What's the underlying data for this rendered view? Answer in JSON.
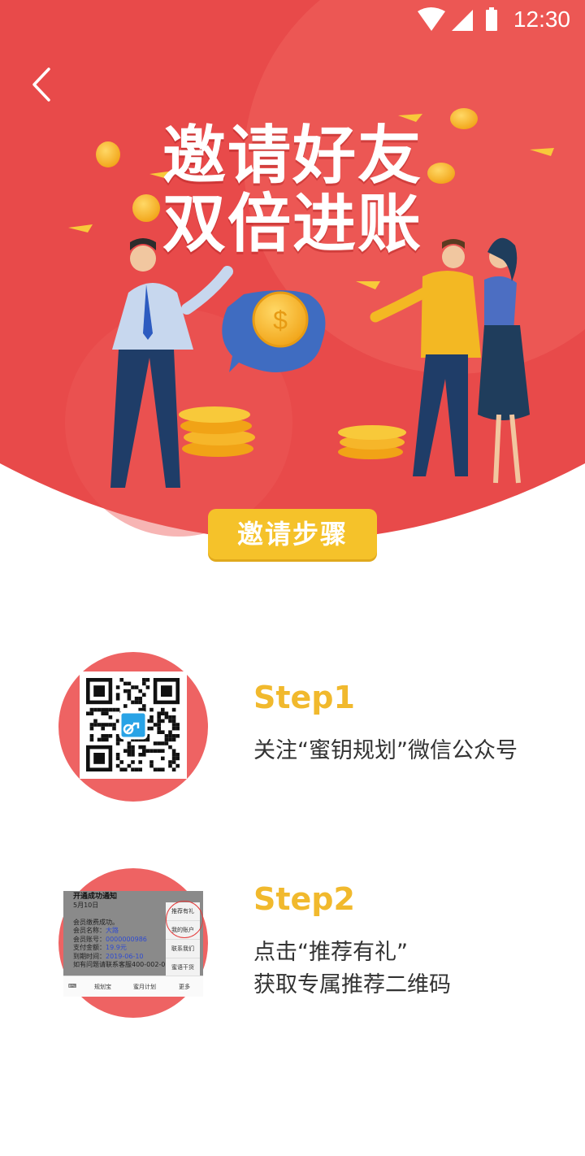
{
  "status_bar": {
    "time": "12:30",
    "icons": [
      "wifi-icon",
      "signal-icon",
      "battery-icon"
    ]
  },
  "header": {
    "back_icon": "chevron-left-icon"
  },
  "hero": {
    "title_line1": "邀请好友",
    "title_line2": "双倍进账",
    "button_label": "邀请步骤"
  },
  "steps": [
    {
      "title": "Step1",
      "desc_lines": [
        "关注“蜜钥规划”微信公众号"
      ]
    },
    {
      "title": "Step2",
      "desc_lines": [
        "点击“推荐有礼”",
        "获取专属推荐二维码"
      ]
    }
  ],
  "step2_screenshot": {
    "message_title": "开通成功通知",
    "message_date": "5月10日",
    "message_lines": [
      "会员缴费成功。",
      "会员名称：",
      "会员账号：",
      "支付金额：",
      "到期时间：",
      "如有问题请联系客服400-002-065"
    ],
    "message_values": [
      "",
      "大路",
      "0000000986",
      "19.9元",
      "2019-06-10",
      ""
    ],
    "menu_items": [
      "推荐有礼",
      "我的账户",
      "联系我们",
      "蜜语干货"
    ],
    "tabs": [
      "规划宝",
      "蜜月计划",
      "更多"
    ]
  },
  "colors": {
    "hero_red": "#e84a4a",
    "hero_red_light": "#ee5c58",
    "accent_yellow": "#f5c22a",
    "step_title": "#f1b92d",
    "step_circle": "#ee6363"
  }
}
